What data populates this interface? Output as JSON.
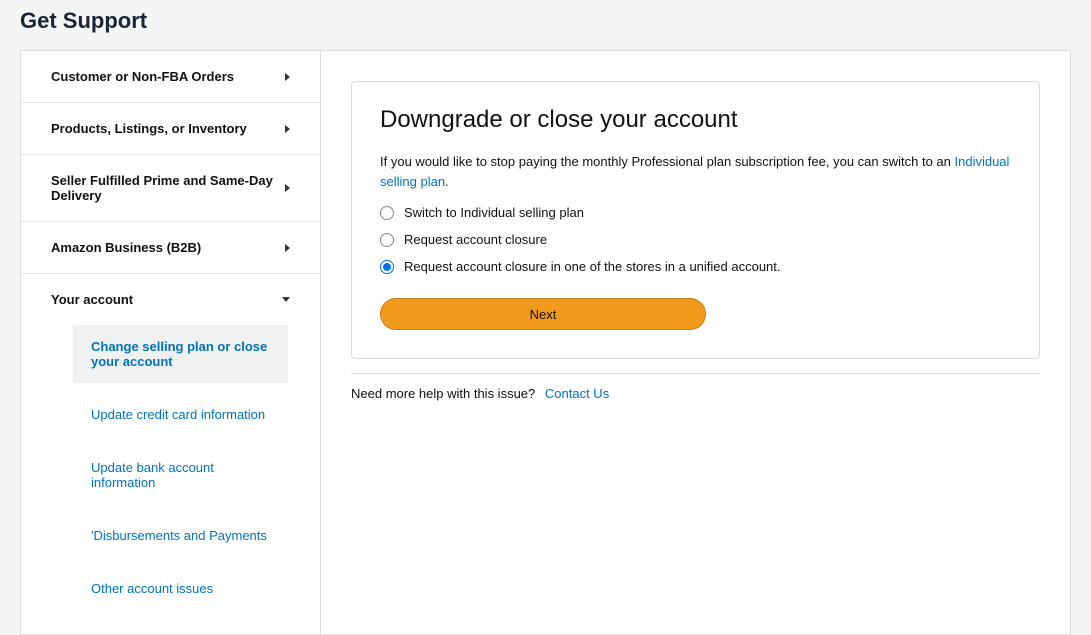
{
  "page": {
    "title": "Get Support"
  },
  "sidebar": {
    "items": [
      {
        "label": "Customer or Non-FBA Orders",
        "expanded": false
      },
      {
        "label": "Products, Listings, or Inventory",
        "expanded": false
      },
      {
        "label": "Seller Fulfilled Prime and Same-Day Delivery",
        "expanded": false
      },
      {
        "label": "Amazon Business (B2B)",
        "expanded": false
      },
      {
        "label": "Your account",
        "expanded": true,
        "children": [
          {
            "label": "Change selling plan or close your account",
            "active": true
          },
          {
            "label": "Update credit card information",
            "active": false
          },
          {
            "label": "Update bank account information",
            "active": false
          },
          {
            "label": "'Disbursements and Payments",
            "active": false
          },
          {
            "label": "Other account issues",
            "active": false
          }
        ]
      }
    ]
  },
  "card": {
    "title": "Downgrade or close your account",
    "intro_prefix": "If you would like to stop paying the monthly Professional plan subscription fee, you can switch to an ",
    "intro_link": "Individual selling plan",
    "intro_suffix": ".",
    "options": [
      {
        "label": "Switch to Individual selling plan",
        "checked": false
      },
      {
        "label": "Request account closure",
        "checked": false
      },
      {
        "label": "Request account closure in one of the stores in a unified account.",
        "checked": true
      }
    ],
    "next_label": "Next"
  },
  "help": {
    "prompt": "Need more help with this issue?",
    "link_label": "Contact Us"
  }
}
